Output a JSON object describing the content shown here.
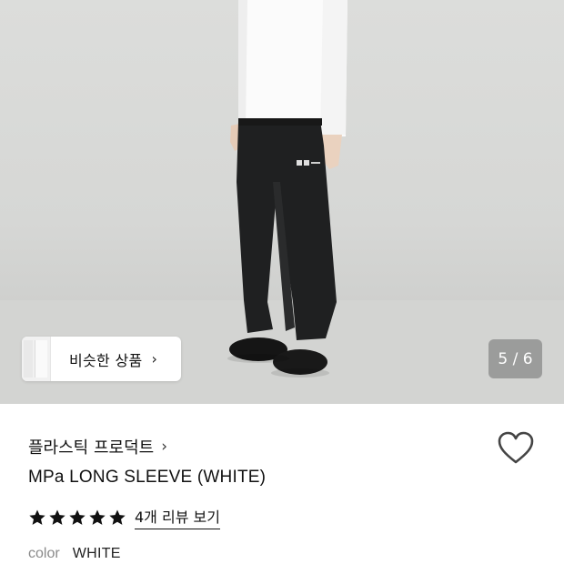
{
  "gallery": {
    "similar_label": "비슷한 상품",
    "similar_chevron": "›",
    "pager": "5 / 6"
  },
  "product": {
    "brand": "플라스틱 프로덕트",
    "brand_chevron": "›",
    "title": "MPa LONG SLEEVE (WHITE)",
    "rating_stars": 5,
    "review_link": "4개 리뷰 보기",
    "color_label": "color",
    "color_value": "WHITE"
  },
  "colors": {
    "background_photo": "#d6d7d5",
    "text": "#111111",
    "muted": "#8a8a8a",
    "pager_bg": "#6e6e6e"
  },
  "icons": {
    "heart": "heart-outline-icon",
    "star": "star-filled-icon",
    "chevron": "chevron-right-icon"
  }
}
